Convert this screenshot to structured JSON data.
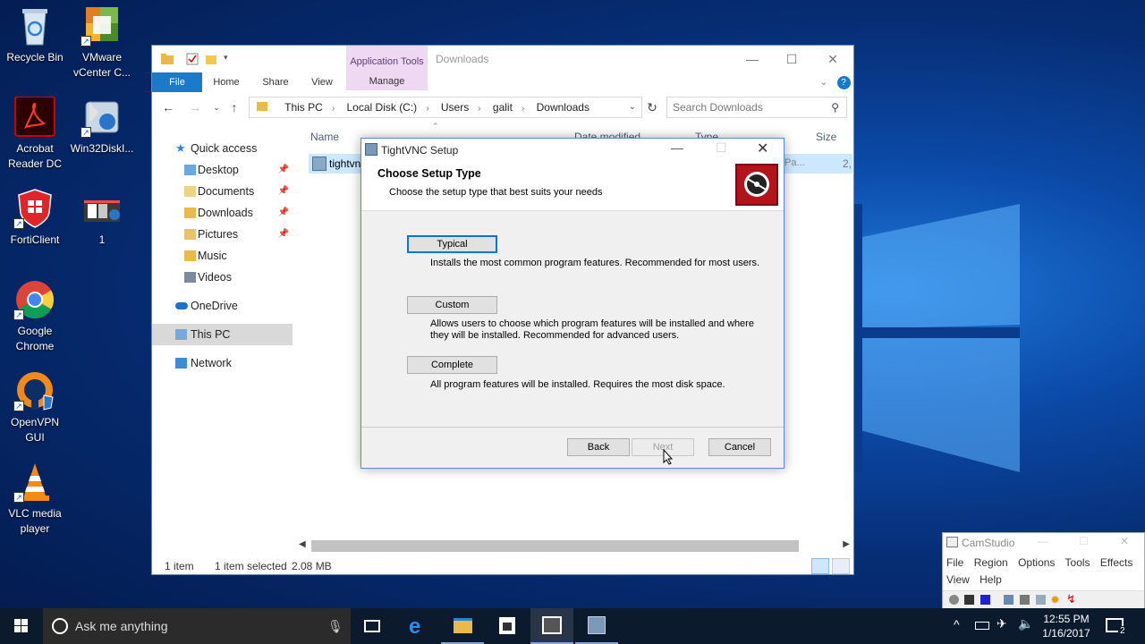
{
  "desktop": {
    "icons": [
      {
        "label": "Recycle Bin"
      },
      {
        "label": "VMware vCenter C..."
      },
      {
        "label": "Acrobat Reader DC"
      },
      {
        "label": "Win32DiskI..."
      },
      {
        "label": "FortiClient"
      },
      {
        "label": "1"
      },
      {
        "label": "Google Chrome"
      },
      {
        "label": "OpenVPN GUI"
      },
      {
        "label": "VLC media player"
      }
    ]
  },
  "explorer": {
    "title": "Downloads",
    "app_tools": "Application Tools",
    "manage": "Manage",
    "tabs": [
      "File",
      "Home",
      "Share",
      "View"
    ],
    "address": [
      "This PC",
      "Local Disk (C:)",
      "Users",
      "galit",
      "Downloads"
    ],
    "search_placeholder": "Search Downloads",
    "nav": {
      "quick_access": "Quick access",
      "items": [
        "Desktop",
        "Documents",
        "Downloads",
        "Pictures",
        "Music",
        "Videos"
      ],
      "onedrive": "OneDrive",
      "this_pc": "This PC",
      "network": "Network"
    },
    "columns": {
      "name": "Name",
      "date": "Date modified",
      "type": "Type",
      "size": "Size"
    },
    "file": {
      "name": "tightvn",
      "type": "Pa...",
      "size": "2,"
    },
    "status": {
      "count": "1 item",
      "selected": "1 item selected",
      "size": "2.08 MB"
    }
  },
  "dialog": {
    "title": "TightVNC Setup",
    "heading": "Choose Setup Type",
    "subheading": "Choose the setup type that best suits your needs",
    "options": [
      {
        "label": "Typical",
        "desc": "Installs the most common program features. Recommended for most users."
      },
      {
        "label": "Custom",
        "desc": "Allows users to choose which program features will be installed and where they will be installed. Recommended for advanced users."
      },
      {
        "label": "Complete",
        "desc": "All program features will be installed. Requires the most disk space."
      }
    ],
    "back": "Back",
    "next": "Next",
    "cancel": "Cancel"
  },
  "camstudio": {
    "title": "CamStudio",
    "menu_row1": [
      "File",
      "Region",
      "Options",
      "Tools",
      "Effects"
    ],
    "menu_row2": [
      "View",
      "Help"
    ]
  },
  "taskbar": {
    "search_placeholder": "Ask me anything",
    "time": "12:55 PM",
    "date": "1/16/2017",
    "notifications": "2"
  }
}
